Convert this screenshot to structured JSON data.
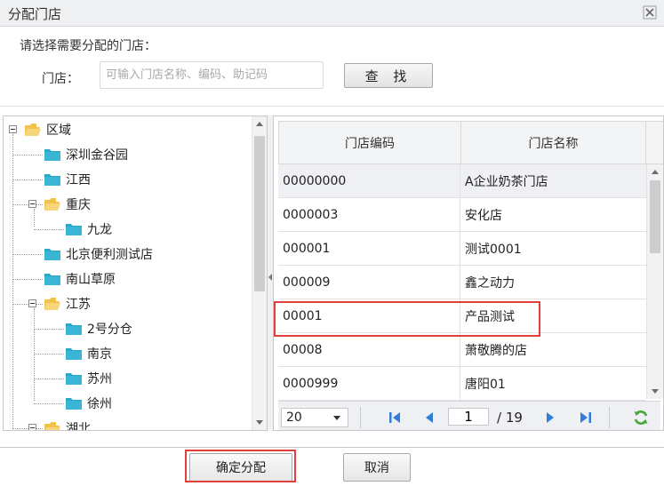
{
  "dialog": {
    "title": "分配门店"
  },
  "form": {
    "prompt": "请选择需要分配的门店：",
    "store_label": "门店：",
    "search_placeholder": "可输入门店名称、编码、助记码",
    "search_value": "",
    "search_button": "查 找"
  },
  "tree": {
    "items": [
      {
        "label": "区域",
        "depth": 0,
        "type": "folder-open"
      },
      {
        "label": "深圳金谷园",
        "depth": 1,
        "type": "folder"
      },
      {
        "label": "江西",
        "depth": 1,
        "type": "folder"
      },
      {
        "label": "重庆",
        "depth": 1,
        "type": "folder-open"
      },
      {
        "label": "九龙",
        "depth": 2,
        "type": "folder"
      },
      {
        "label": "北京便利测试店",
        "depth": 1,
        "type": "folder"
      },
      {
        "label": "南山草原",
        "depth": 1,
        "type": "folder"
      },
      {
        "label": "江苏",
        "depth": 1,
        "type": "folder-open"
      },
      {
        "label": "2号分仓",
        "depth": 2,
        "type": "folder"
      },
      {
        "label": "南京",
        "depth": 2,
        "type": "folder"
      },
      {
        "label": "苏州",
        "depth": 2,
        "type": "folder"
      },
      {
        "label": "徐州",
        "depth": 2,
        "type": "folder"
      },
      {
        "label": "湖北",
        "depth": 1,
        "type": "folder-open"
      }
    ]
  },
  "grid": {
    "columns": [
      "门店编码",
      "门店名称"
    ],
    "rows": [
      {
        "code": "00000000",
        "name": "A企业奶茶门店",
        "selected": true
      },
      {
        "code": "0000003",
        "name": "安化店",
        "selected": false
      },
      {
        "code": "000001",
        "name": "测试0001",
        "selected": false
      },
      {
        "code": "000009",
        "name": "鑫之动力",
        "selected": false
      },
      {
        "code": "00001",
        "name": "产品测试",
        "selected": false,
        "highlighted": true
      },
      {
        "code": "00008",
        "name": "萧敬腾的店",
        "selected": false
      },
      {
        "code": "0000999",
        "name": "唐阳01",
        "selected": false
      }
    ]
  },
  "pager": {
    "page_size": "20",
    "current_page": "1",
    "total_pages": "/ 19"
  },
  "footer": {
    "confirm": "确定分配",
    "cancel": "取消"
  },
  "colors": {
    "highlight_box": "#e0403a",
    "folder": "#f3c24b",
    "folder_closed": "#2ba6c8",
    "pager_icon": "#2f7fd8",
    "refresh_icon": "#4aa63a"
  }
}
